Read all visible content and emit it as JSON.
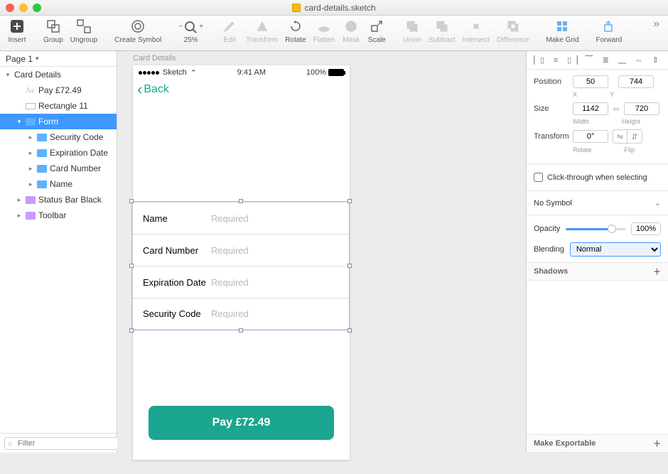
{
  "title": "card-details.sketch",
  "toolbar": {
    "insert": "Insert",
    "group": "Group",
    "ungroup": "Ungroup",
    "create_symbol": "Create Symbol",
    "zoom": "25%",
    "edit": "Edit",
    "transform": "Transform",
    "rotate": "Rotate",
    "flatten": "Flatten",
    "mask": "Mask",
    "scale": "Scale",
    "union": "Union",
    "subtract": "Subtract",
    "intersect": "Intersect",
    "difference": "Difference",
    "make_grid": "Make Grid",
    "forward": "Forward"
  },
  "left": {
    "page": "Page 1",
    "tree": {
      "root": "Card Details",
      "pay": "Pay £72.49",
      "rect": "Rectangle 11",
      "form": "Form",
      "children": [
        "Security Code",
        "Expiration Date",
        "Card Number",
        "Name"
      ],
      "statusbar": "Status Bar Black",
      "toolbar": "Toolbar"
    },
    "filter_placeholder": "Filter"
  },
  "canvas": {
    "artboard_name": "Card Details",
    "status": {
      "carrier": "Sketch",
      "time": "9:41 AM",
      "battery": "100%"
    },
    "back": "Back",
    "form": [
      {
        "label": "Name",
        "placeholder": "Required"
      },
      {
        "label": "Card Number",
        "placeholder": "Required"
      },
      {
        "label": "Expiration Date",
        "placeholder": "Required"
      },
      {
        "label": "Security Code",
        "placeholder": "Required"
      }
    ],
    "pay_button": "Pay £72.49"
  },
  "inspector": {
    "position_label": "Position",
    "x": "50",
    "y": "744",
    "x_lab": "X",
    "y_lab": "Y",
    "size_label": "Size",
    "width": "1142",
    "height": "720",
    "w_lab": "Width",
    "h_lab": "Height",
    "transform_label": "Transform",
    "rotate": "0°",
    "rotate_lab": "Rotate",
    "flip_lab": "Flip",
    "clickthrough": "Click-through when selecting",
    "no_symbol": "No Symbol",
    "opacity_label": "Opacity",
    "opacity_val": "100%",
    "blending_label": "Blending",
    "blending_val": "Normal",
    "shadows": "Shadows",
    "make_exportable": "Make Exportable"
  }
}
